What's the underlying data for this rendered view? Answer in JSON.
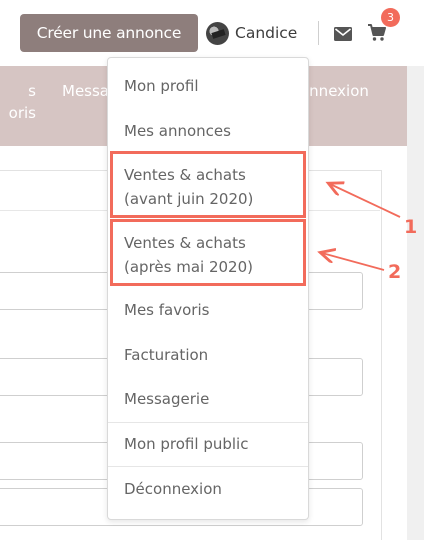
{
  "header": {
    "create_button": "Créer une annonce",
    "user_name": "Candice",
    "cart_count": "3"
  },
  "nav": {
    "left_line1": "s",
    "left_line2": "oris",
    "middle": "Messa",
    "right": "onnexion"
  },
  "dropdown": {
    "items": [
      {
        "label": "Mon profil"
      },
      {
        "label": "Mes annonces"
      },
      {
        "line1": "Ventes & achats",
        "line2": "(avant juin 2020)"
      },
      {
        "line1": "Ventes & achats",
        "line2": "(après mai 2020)"
      },
      {
        "label": "Mes favoris"
      },
      {
        "label": "Facturation"
      },
      {
        "label": "Messagerie"
      },
      {
        "label": "Mon profil public"
      },
      {
        "label": "Déconnexion"
      }
    ]
  },
  "annotations": {
    "callout_1": "1",
    "callout_2": "2"
  },
  "colors": {
    "primary_button": "#8e7e7c",
    "nav_band": "#d6c5c3",
    "highlight": "#f26b5b",
    "badge": "#f26b5b"
  },
  "icons": [
    "avatar",
    "mail-icon",
    "cart-icon"
  ]
}
